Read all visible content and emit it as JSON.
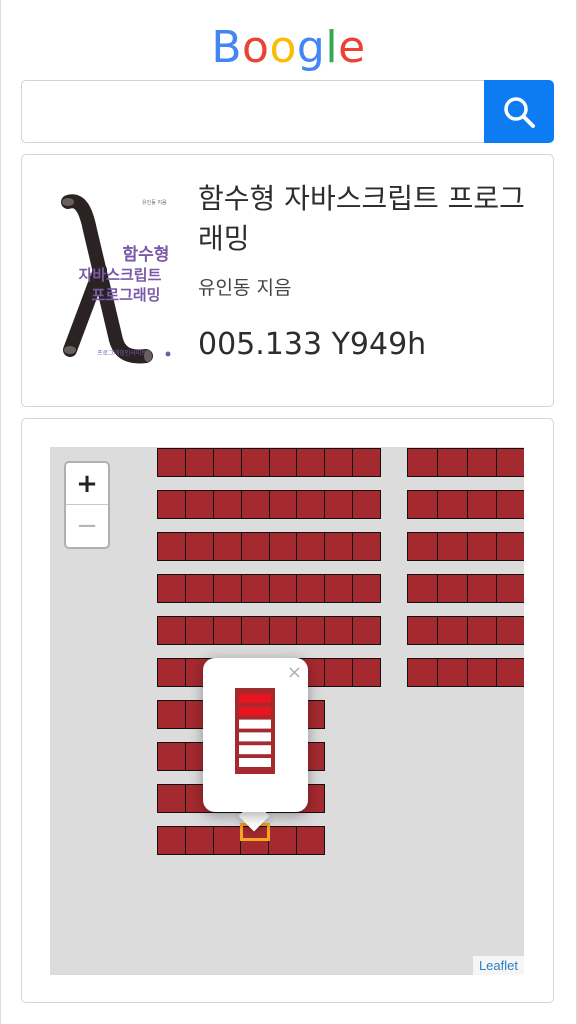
{
  "logo": {
    "letters": [
      {
        "char": "B",
        "color": "#4285f4"
      },
      {
        "char": "o",
        "color": "#ea4335"
      },
      {
        "char": "o",
        "color": "#fbbc05"
      },
      {
        "char": "g",
        "color": "#4285f4"
      },
      {
        "char": "l",
        "color": "#34a853"
      },
      {
        "char": "e",
        "color": "#ea4335"
      }
    ]
  },
  "search": {
    "value": "",
    "placeholder": "",
    "button_icon": "search-icon",
    "button_color": "#0d7cf2"
  },
  "book": {
    "title": "함수형 자바스크립트 프로그래밍",
    "author": "유인동 지음",
    "call_number": "005.133 Y949h",
    "cover": {
      "title_lines": [
        "함수형",
        "자바스크립트",
        "프로그래밍"
      ],
      "publisher": "프로그래밍인사이트",
      "author_small": "유인동 지음",
      "symbol": "λ"
    }
  },
  "map": {
    "zoom_in_label": "+",
    "zoom_out_label": "−",
    "attribution": "Leaflet",
    "popup_close": "×",
    "shelf_color": "#a52a2f",
    "highlight_color": "#f5a623",
    "popup_shelf_levels": 6,
    "popup_highlighted_levels": [
      1,
      2
    ]
  }
}
